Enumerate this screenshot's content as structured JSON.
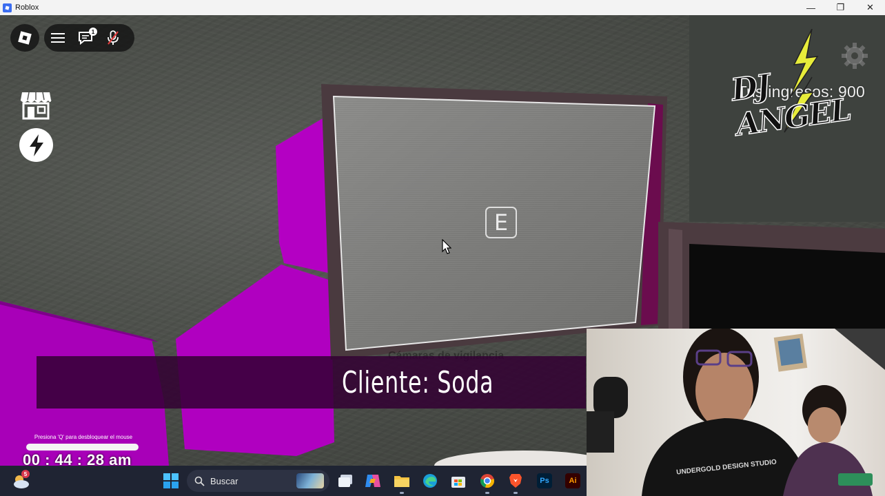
{
  "window": {
    "title": "Roblox",
    "controls": {
      "minimize": "—",
      "maximize": "❐",
      "close": "✕"
    }
  },
  "hud": {
    "chat_badge": "1",
    "ingresos_label": "Tus ingresos: 900",
    "streamer_logo": "DJ ANGEL"
  },
  "screen": {
    "prompt_key": "E"
  },
  "dialogue": {
    "ghost_text": "Cámaras de vigilancia",
    "text": "Cliente: Soda"
  },
  "clock": {
    "hint": "Presiona 'Q' para desbloquear el mouse",
    "progress": 1.0,
    "time": "00 : 44 : 28 am"
  },
  "webcam": {
    "shirt_text": "UNDERGOLD DESIGN STUDIO"
  },
  "taskbar": {
    "weather_badge": "5",
    "search_placeholder": "Buscar",
    "ps_label": "Ps",
    "ai_label": "Ai"
  },
  "colors": {
    "magenta": "#b400c3",
    "dialog_bg": "#320032",
    "taskbar_bg": "#1f2433"
  }
}
